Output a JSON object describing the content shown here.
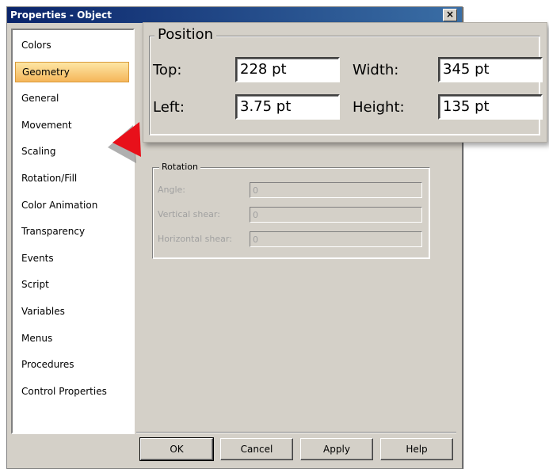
{
  "window": {
    "title": "Properties - Object",
    "close_label": "×"
  },
  "sidebar": {
    "items": [
      {
        "label": "Colors",
        "selected": false
      },
      {
        "label": "Geometry",
        "selected": true
      },
      {
        "label": "General",
        "selected": false
      },
      {
        "label": "Movement",
        "selected": false
      },
      {
        "label": "Scaling",
        "selected": false
      },
      {
        "label": "Rotation/Fill",
        "selected": false
      },
      {
        "label": "Color Animation",
        "selected": false
      },
      {
        "label": "Transparency",
        "selected": false
      },
      {
        "label": "Events",
        "selected": false
      },
      {
        "label": "Script",
        "selected": false
      },
      {
        "label": "Variables",
        "selected": false
      },
      {
        "label": "Menus",
        "selected": false
      },
      {
        "label": "Procedures",
        "selected": false
      },
      {
        "label": "Control Properties",
        "selected": false
      }
    ]
  },
  "position": {
    "legend": "Position",
    "top_label": "Top:",
    "top_value": "228 pt",
    "left_label": "Left:",
    "left_value": "3.75 pt",
    "width_label": "Width:",
    "width_value": "345 pt",
    "height_label": "Height:",
    "height_value": "135 pt"
  },
  "rotation": {
    "legend": "Rotation",
    "angle_label": "Angle:",
    "angle_value": "0",
    "vshear_label": "Vertical shear:",
    "vshear_value": "0",
    "hshear_label": "Horizontal shear:",
    "hshear_value": "0"
  },
  "buttons": {
    "ok": "OK",
    "cancel": "Cancel",
    "apply": "Apply",
    "help": "Help"
  },
  "colors": {
    "accent_arrow": "#e8101a",
    "selected_item": "#f5b65a",
    "dialog_bg": "#d4d0c8"
  }
}
